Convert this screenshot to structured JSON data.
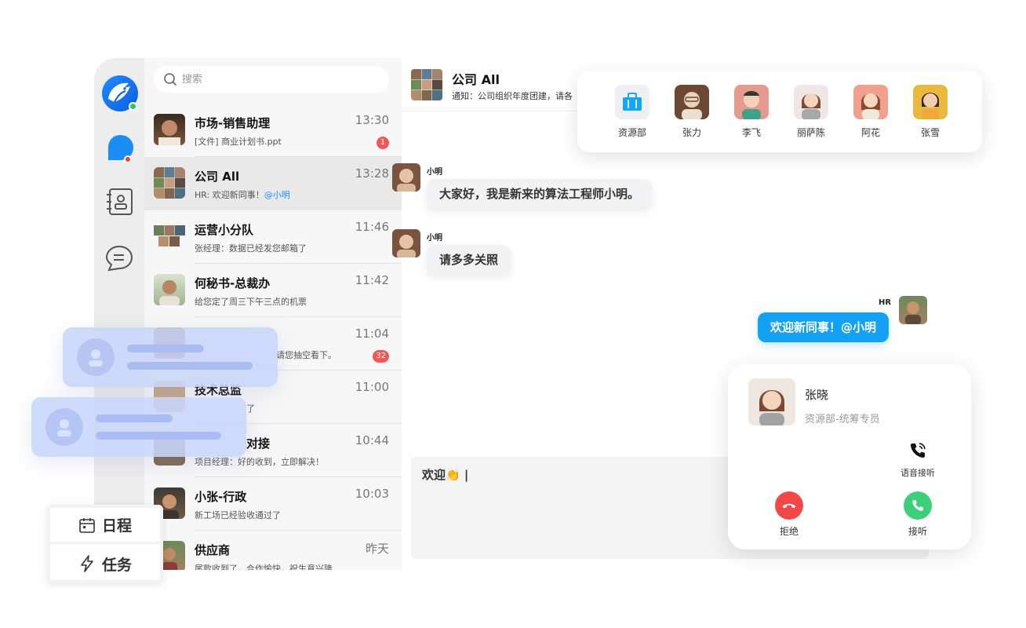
{
  "search": {
    "placeholder": "搜索"
  },
  "conversations": [
    {
      "name": "市场-销售助理",
      "preview": "[文件] 商业计划书.ppt",
      "time": "13:30",
      "badge": "1"
    },
    {
      "name": "公司 All",
      "preview": "HR: 欢迎新同事！",
      "mention": "@小明",
      "time": "13:28"
    },
    {
      "name": "运营小分队",
      "preview": "张经理：数据已经发您邮箱了",
      "time": "11:46"
    },
    {
      "name": "何秘书-总裁办",
      "preview": "给您定了周三下午三点的机票",
      "time": "11:42"
    },
    {
      "name": "",
      "preview": "请您抽空看下。",
      "time": "11:04",
      "badge": "32"
    },
    {
      "name": "技术总监",
      "preview": "了",
      "time": "11:00"
    },
    {
      "name": "对接",
      "preview": "项目经理：好的收到，立即解决！",
      "time": "10:44"
    },
    {
      "name": "小张-行政",
      "preview": "新工场已经验收通过了",
      "time": "10:03"
    },
    {
      "name": "供应商",
      "preview": "尾款收到了，合作愉快，祝生意兴隆",
      "time": "昨天"
    }
  ],
  "chat": {
    "title": "公司 All",
    "notice": "通知：公司组织年度团建，请各",
    "messages": [
      {
        "sender": "小明",
        "text": "大家好，我是新来的算法工程师小明。"
      },
      {
        "sender": "小明",
        "text": "请多多关照"
      },
      {
        "sender": "HR",
        "text": "欢迎新同事！@小明"
      }
    ],
    "draft": "欢迎👏 |"
  },
  "contacts_card": {
    "items": [
      {
        "label": "资源部",
        "icon": "briefcase-icon",
        "color": "#15a7f0"
      },
      {
        "label": "张力"
      },
      {
        "label": "李飞"
      },
      {
        "label": "丽萨陈"
      },
      {
        "label": "阿花"
      },
      {
        "label": "张雪"
      }
    ]
  },
  "call_card": {
    "name": "张晓",
    "role": "资源部-统筹专员",
    "voice_label": "语音接听",
    "decline_label": "拒绝",
    "accept_label": "接听",
    "decline_color": "#f24848",
    "accept_color": "#3ecf7c"
  },
  "side_tabs": {
    "schedule": "日程",
    "tasks": "任务"
  }
}
